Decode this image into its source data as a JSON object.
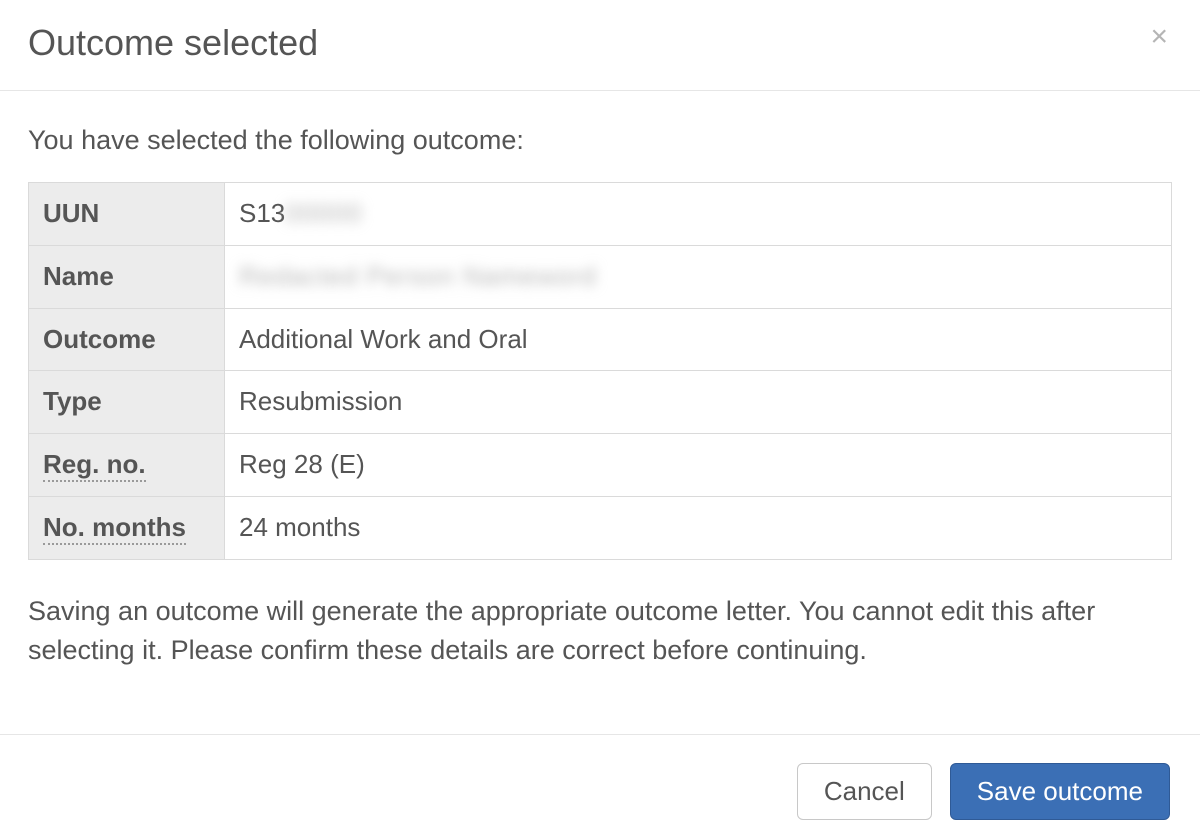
{
  "modal": {
    "title": "Outcome selected",
    "close_label": "×"
  },
  "body": {
    "intro": "You have selected the following outcome:",
    "rows": {
      "uun": {
        "label": "UUN",
        "value_prefix": "S13",
        "value_blurred": ""
      },
      "name": {
        "label": "Name",
        "value_blurred": "Redacted Person Nameword"
      },
      "outcome": {
        "label": "Outcome",
        "value": "Additional Work and Oral"
      },
      "type": {
        "label": "Type",
        "value": "Resubmission"
      },
      "regno": {
        "label": "Reg. no.",
        "value": "Reg 28 (E)"
      },
      "months": {
        "label": "No. months",
        "value": "24 months"
      }
    },
    "warning": "Saving an outcome will generate the appropriate outcome letter. You cannot edit this after selecting it. Please confirm these details are correct before continuing."
  },
  "footer": {
    "cancel_label": "Cancel",
    "save_label": "Save outcome"
  }
}
